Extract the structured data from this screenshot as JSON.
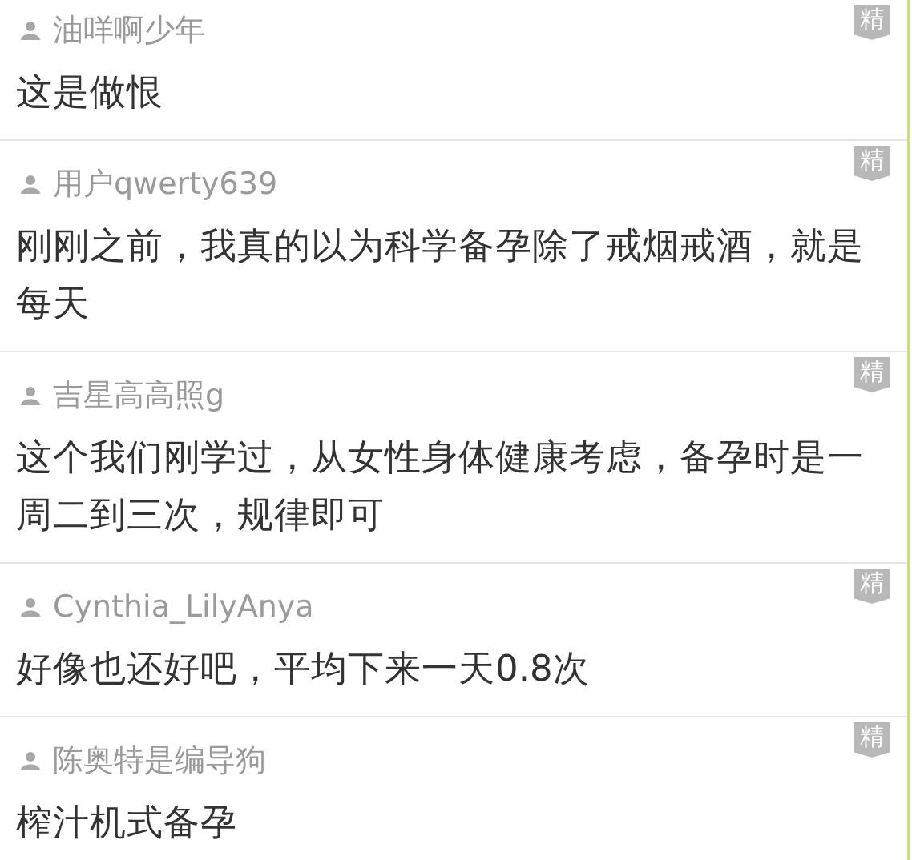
{
  "comments": [
    {
      "user": "油咩啊少年",
      "text": "这是做恨",
      "badge": "精"
    },
    {
      "user": "用户qwerty639",
      "text": "刚刚之前，我真的以为科学备孕除了戒烟戒酒，就是每天",
      "badge": "精"
    },
    {
      "user": "吉星高高照g",
      "text": "这个我们刚学过，从女性身体健康考虑，备孕时是一周二到三次，规律即可",
      "badge": "精"
    },
    {
      "user": "Cynthia_LilyAnya",
      "text": "好像也还好吧，平均下来一天0.8次",
      "badge": "精"
    },
    {
      "user": "陈奥特是编导狗",
      "text": "榨汁机式备孕",
      "badge": "精"
    }
  ]
}
